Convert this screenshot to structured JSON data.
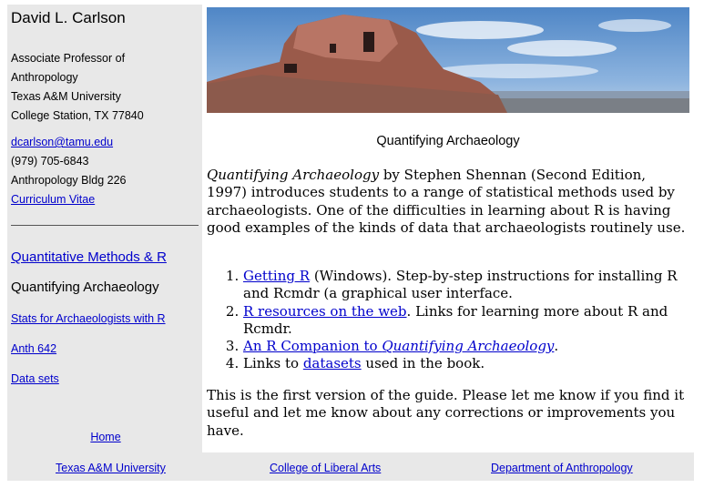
{
  "sidebar": {
    "name": "David L. Carlson",
    "title_line1": "Associate Professor of",
    "title_line2": "Anthropology",
    "university": "Texas A&M University",
    "city": "College Station, TX 77840",
    "email": "dcarlson@tamu.edu",
    "phone": "(979) 705-6843",
    "office": "Anthropology Bldg 226",
    "cv": "Curriculum Vitae",
    "nav_quant": "Quantitative Methods & R",
    "nav_current": "Quantifying Archaeology",
    "nav_stats": "Stats for Archaeologists with R",
    "nav_anth": "Anth 642",
    "nav_data": "Data sets",
    "home": "Home"
  },
  "main": {
    "subtitle": "Quantifying Archaeology",
    "intro_title": "Quantifying Archaeology",
    "intro_rest": " by Stephen Shennan (Second Edition, 1997) introduces students to a range of statistical methods used by archaeologists. One of the difficulties in learning about R is having good examples of the kinds of data that archaeologists routinely use.",
    "items": [
      {
        "link": "Getting R",
        "text": " (Windows). Step-by-step instructions for installing R and Rcmdr (a graphical user interface."
      },
      {
        "link": "R resources on the web",
        "text": ". Links for learning more about R and Rcmdr."
      },
      {
        "link_a": "An R Companion to ",
        "link_b": "Quantifying Archaeology",
        "text": "."
      },
      {
        "pre": "Links to ",
        "link": "datasets",
        "text": " used in the book."
      }
    ],
    "closing": "This is the first version of the guide. Please let me know if you find it useful and let me know about any corrections or improvements you have."
  },
  "footer": {
    "link1": "Texas A&M University",
    "link2": "College of Liberal Arts",
    "link3": "Department of Anthropology"
  },
  "colors": {
    "link": "#0000cc",
    "panel": "#e8e8e8"
  }
}
